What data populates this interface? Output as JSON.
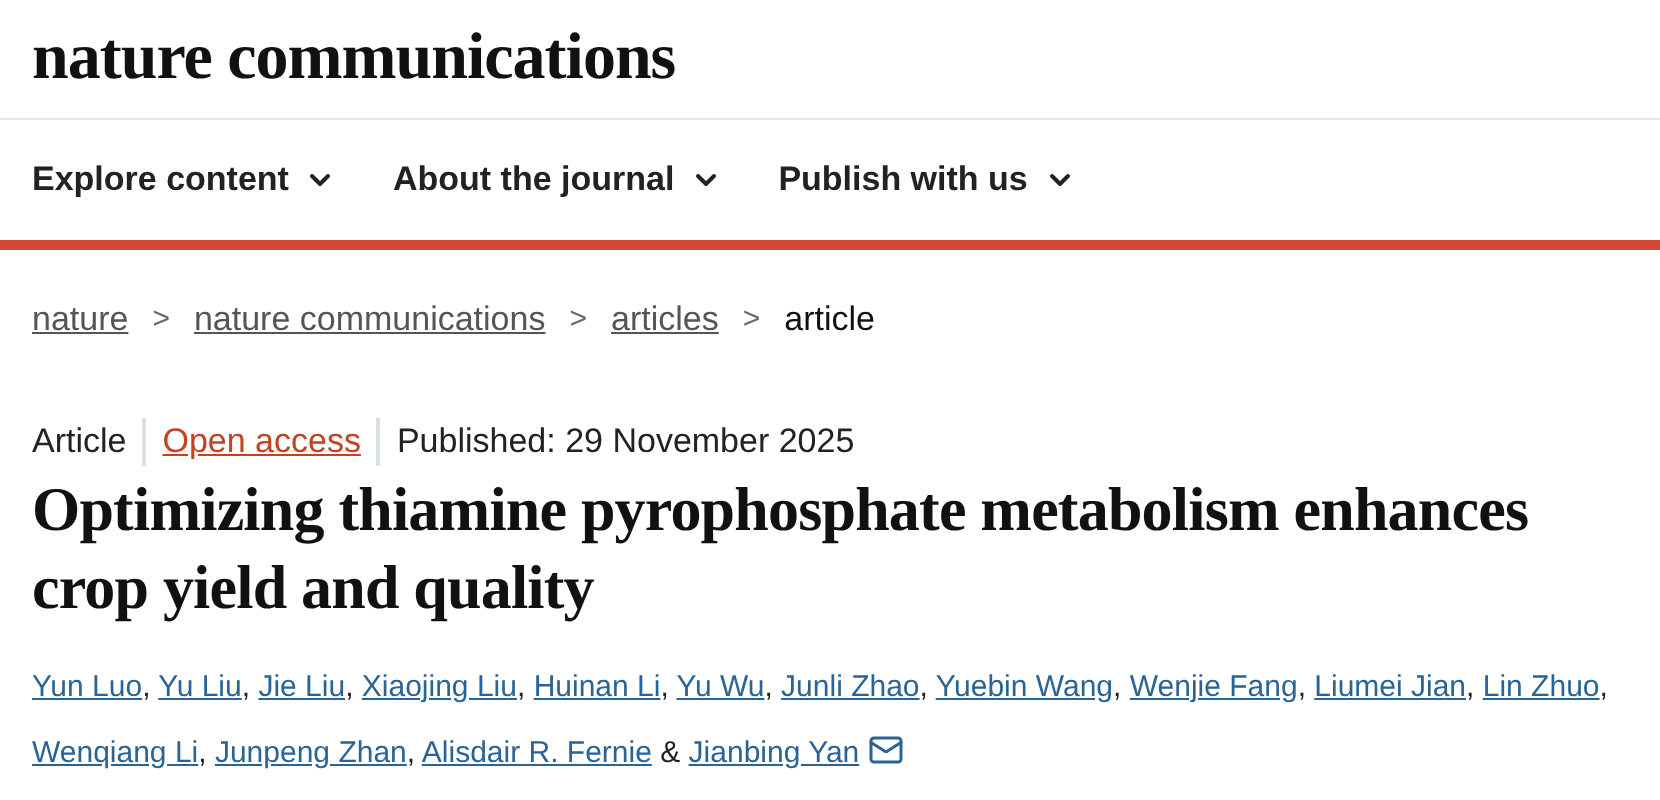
{
  "logo": "nature communications",
  "nav": [
    "Explore content",
    "About the journal",
    "Publish with us"
  ],
  "breadcrumb": {
    "links": [
      "nature",
      "nature communications",
      "articles"
    ],
    "current": "article",
    "separator": ">"
  },
  "meta": {
    "type": "Article",
    "access": "Open access",
    "published": "Published: 29 November 2025"
  },
  "title": "Optimizing thiamine pyrophosphate metabolism enhances crop yield and quality",
  "authors": [
    "Yun Luo",
    "Yu Liu",
    "Jie Liu",
    "Xiaojing Liu",
    "Huinan Li",
    "Yu Wu",
    "Junli Zhao",
    "Yuebin Wang",
    "Wenjie Fang",
    "Liumei Jian",
    "Lin Zhuo",
    "Wenqiang Li",
    "Junpeng Zhan",
    "Alisdair R. Fernie",
    "Jianbing Yan"
  ],
  "authors_separator": ",",
  "authors_joiner": "&"
}
